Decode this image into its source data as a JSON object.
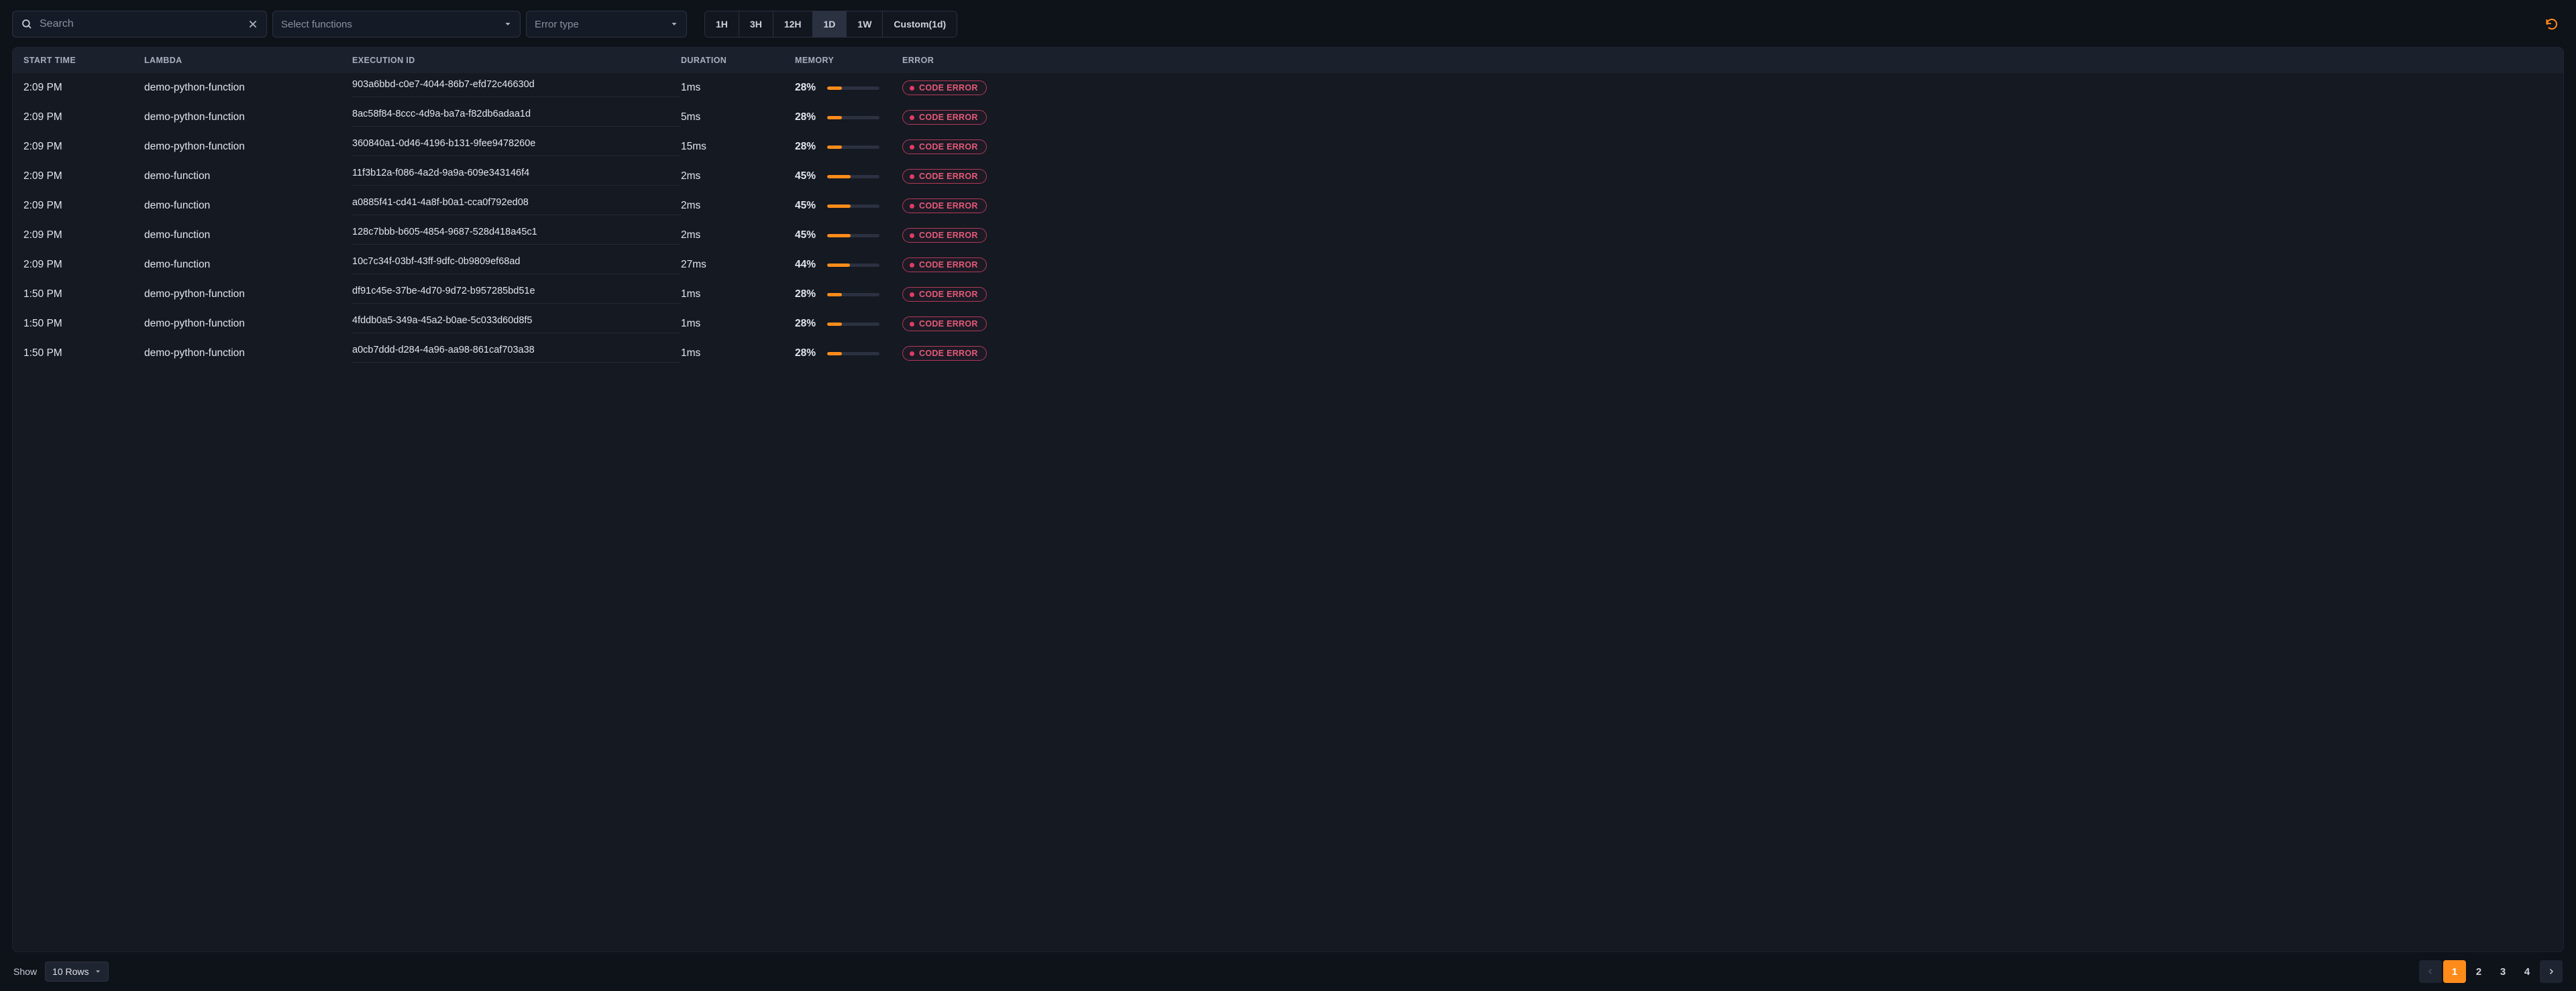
{
  "toolbar": {
    "search_placeholder": "Search",
    "select_functions_label": "Select functions",
    "error_type_label": "Error type",
    "time_ranges": [
      "1H",
      "3H",
      "12H",
      "1D",
      "1W",
      "Custom(1d)"
    ],
    "active_time_range": "1D"
  },
  "columns": {
    "start_time": "START TIME",
    "lambda": "LAMBDA",
    "execution_id": "EXECUTION ID",
    "duration": "DURATION",
    "memory": "MEMORY",
    "error": "ERROR"
  },
  "rows": [
    {
      "start_time": "2:09 PM",
      "lambda": "demo-python-function",
      "execution_id": "903a6bbd-c0e7-4044-86b7-efd72c46630d",
      "duration": "1ms",
      "memory_pct": 28,
      "memory_label": "28%",
      "error": "CODE ERROR"
    },
    {
      "start_time": "2:09 PM",
      "lambda": "demo-python-function",
      "execution_id": "8ac58f84-8ccc-4d9a-ba7a-f82db6adaa1d",
      "duration": "5ms",
      "memory_pct": 28,
      "memory_label": "28%",
      "error": "CODE ERROR"
    },
    {
      "start_time": "2:09 PM",
      "lambda": "demo-python-function",
      "execution_id": "360840a1-0d46-4196-b131-9fee9478260e",
      "duration": "15ms",
      "memory_pct": 28,
      "memory_label": "28%",
      "error": "CODE ERROR"
    },
    {
      "start_time": "2:09 PM",
      "lambda": "demo-function",
      "execution_id": "11f3b12a-f086-4a2d-9a9a-609e343146f4",
      "duration": "2ms",
      "memory_pct": 45,
      "memory_label": "45%",
      "error": "CODE ERROR"
    },
    {
      "start_time": "2:09 PM",
      "lambda": "demo-function",
      "execution_id": "a0885f41-cd41-4a8f-b0a1-cca0f792ed08",
      "duration": "2ms",
      "memory_pct": 45,
      "memory_label": "45%",
      "error": "CODE ERROR"
    },
    {
      "start_time": "2:09 PM",
      "lambda": "demo-function",
      "execution_id": "128c7bbb-b605-4854-9687-528d418a45c1",
      "duration": "2ms",
      "memory_pct": 45,
      "memory_label": "45%",
      "error": "CODE ERROR"
    },
    {
      "start_time": "2:09 PM",
      "lambda": "demo-function",
      "execution_id": "10c7c34f-03bf-43ff-9dfc-0b9809ef68ad",
      "duration": "27ms",
      "memory_pct": 44,
      "memory_label": "44%",
      "error": "CODE ERROR"
    },
    {
      "start_time": "1:50 PM",
      "lambda": "demo-python-function",
      "execution_id": "df91c45e-37be-4d70-9d72-b957285bd51e",
      "duration": "1ms",
      "memory_pct": 28,
      "memory_label": "28%",
      "error": "CODE ERROR"
    },
    {
      "start_time": "1:50 PM",
      "lambda": "demo-python-function",
      "execution_id": "4fddb0a5-349a-45a2-b0ae-5c033d60d8f5",
      "duration": "1ms",
      "memory_pct": 28,
      "memory_label": "28%",
      "error": "CODE ERROR"
    },
    {
      "start_time": "1:50 PM",
      "lambda": "demo-python-function",
      "execution_id": "a0cb7ddd-d284-4a96-aa98-861caf703a38",
      "duration": "1ms",
      "memory_pct": 28,
      "memory_label": "28%",
      "error": "CODE ERROR"
    }
  ],
  "footer": {
    "show_label": "Show",
    "rows_label": "10 Rows",
    "pages": [
      "1",
      "2",
      "3",
      "4"
    ],
    "active_page": "1"
  },
  "colors": {
    "accent": "#ff8c1a",
    "error": "#e45a78"
  }
}
